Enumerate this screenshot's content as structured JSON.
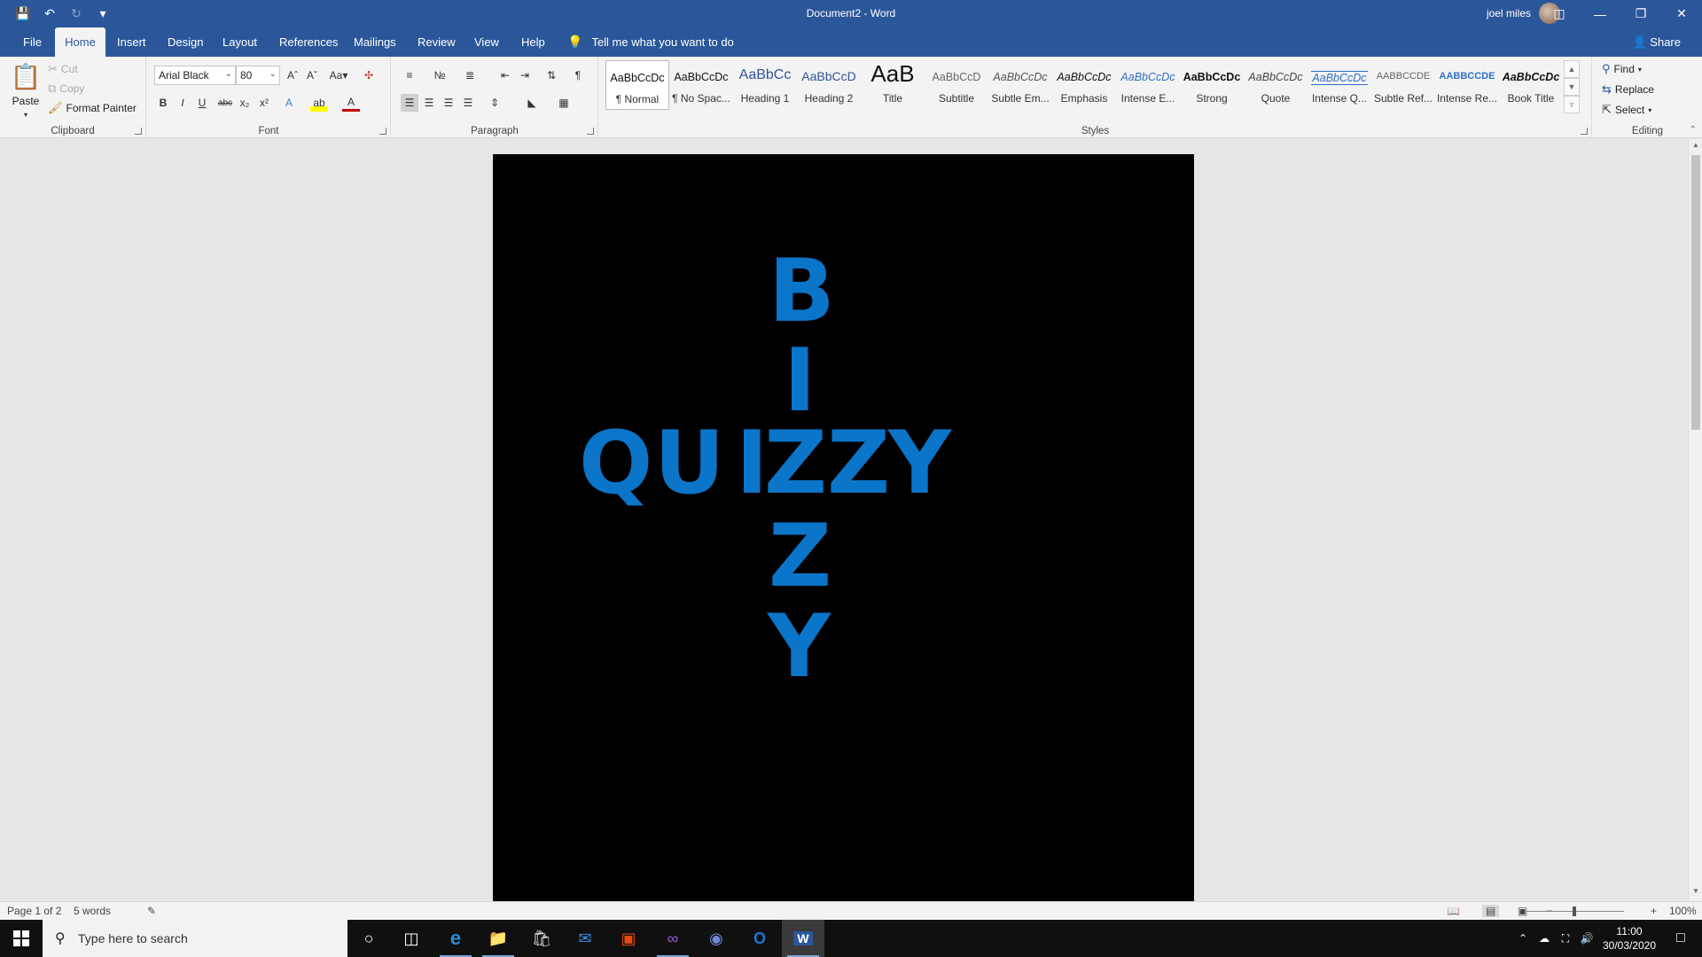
{
  "titlebar": {
    "doc_title": "Document2 - Word",
    "user_name": "joel miles"
  },
  "tabs": [
    "File",
    "Home",
    "Insert",
    "Design",
    "Layout",
    "References",
    "Mailings",
    "Review",
    "View",
    "Help"
  ],
  "active_tab": "Home",
  "tell_me": "Tell me what you want to do",
  "share_label": "Share",
  "clipboard": {
    "paste": "Paste",
    "cut": "Cut",
    "copy": "Copy",
    "format_painter": "Format Painter",
    "label": "Clipboard"
  },
  "font": {
    "family": "Arial Black",
    "size": "80",
    "label": "Font"
  },
  "paragraph": {
    "label": "Paragraph"
  },
  "styles": {
    "label": "Styles",
    "items": [
      {
        "preview": "AaBbCcDc",
        "name": "¶ Normal"
      },
      {
        "preview": "AaBbCcDc",
        "name": "¶ No Spac..."
      },
      {
        "preview": "AaBbCc",
        "name": "Heading 1"
      },
      {
        "preview": "AaBbCcD",
        "name": "Heading 2"
      },
      {
        "preview": "AaB",
        "name": "Title"
      },
      {
        "preview": "AaBbCcD",
        "name": "Subtitle"
      },
      {
        "preview": "AaBbCcDc",
        "name": "Subtle Em..."
      },
      {
        "preview": "AaBbCcDc",
        "name": "Emphasis"
      },
      {
        "preview": "AaBbCcDc",
        "name": "Intense E..."
      },
      {
        "preview": "AaBbCcDc",
        "name": "Strong"
      },
      {
        "preview": "AaBbCcDc",
        "name": "Quote"
      },
      {
        "preview": "AaBbCcDc",
        "name": "Intense Q..."
      },
      {
        "preview": "AABBCCDE",
        "name": "Subtle Ref..."
      },
      {
        "preview": "AABBCCDE",
        "name": "Intense Re..."
      },
      {
        "preview": "AaBbCcDc",
        "name": "Book Title"
      }
    ]
  },
  "editing": {
    "find": "Find",
    "replace": "Replace",
    "select": "Select",
    "label": "Editing"
  },
  "document": {
    "vertical_word": "BIZZY",
    "horizontal_word": "QUIZZY",
    "text_color": "#0a75c9",
    "page_color": "#000000"
  },
  "statusbar": {
    "page": "Page 1 of 2",
    "words": "5 words",
    "zoom": "100%"
  },
  "taskbar": {
    "search_placeholder": "Type here to search",
    "time": "11:00",
    "date": "30/03/2020"
  }
}
